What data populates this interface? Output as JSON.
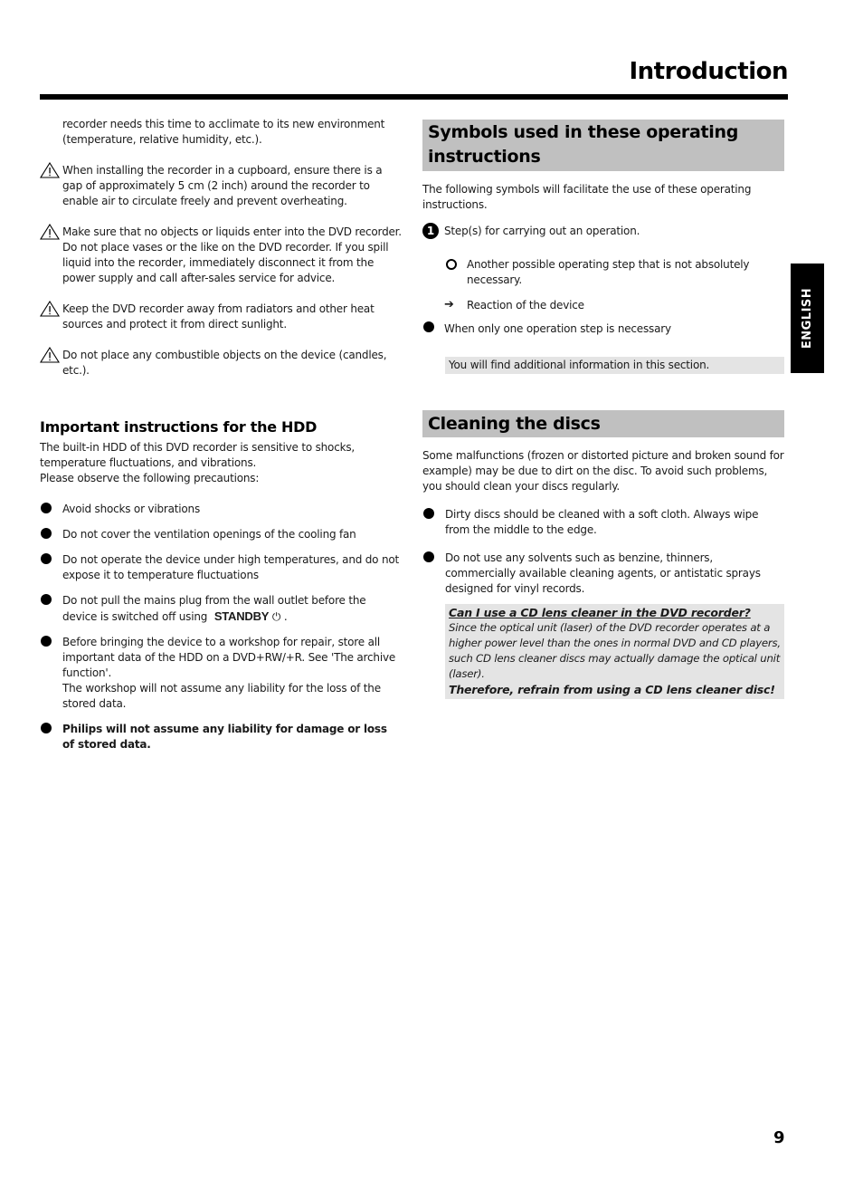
{
  "header": {
    "title": "Introduction"
  },
  "left": {
    "intro_text": "recorder needs this time to acclimate to its new environment (temperature, relative humidity, etc.).",
    "warnings": [
      {
        "icon": "warning-triangle-icon",
        "text": "When installing the recorder in a cupboard, ensure there is a gap of approximately 5 cm (2 inch) around the recorder to enable air to circulate freely and prevent overheating."
      },
      {
        "icon": "warning-triangle-icon",
        "text": "Make sure that no objects or liquids enter into the DVD recorder. Do not place vases or the like on the DVD recorder. If you spill liquid into the recorder, immediately disconnect it from the power supply and call after-sales service for advice."
      },
      {
        "icon": "warning-triangle-icon",
        "text": "Keep the DVD recorder away from radiators and other heat sources and protect it from direct sunlight."
      },
      {
        "icon": "warning-triangle-icon",
        "text": "Do not place any combustible objects on the device (candles, etc.)."
      }
    ],
    "hdd": {
      "heading": "Important instructions for the HDD",
      "intro_lines": [
        "The built-in HDD of this DVD recorder is sensitive to shocks, temperature fluctuations, and vibrations.",
        "Please observe the following precautions:"
      ],
      "bullets": [
        {
          "text": "Avoid shocks or vibrations"
        },
        {
          "text": "Do not cover the ventilation openings of the cooling fan"
        },
        {
          "text": "Do not operate the device under high temperatures, and do not expose it to temperature fluctuations"
        },
        {
          "text": "Do not pull the mains plug from the wall outlet before the device is switched off using",
          "key": "STANDBY",
          "key_icon": "power-icon",
          "key_glyph": "⏻",
          "suffix": " ."
        },
        {
          "text": "Before bringing the device to a workshop for repair, store all important data of the HDD on a DVD+RW/+R. See 'The archive function'.",
          "text2": "The workshop will not assume any liability for the loss of the stored data."
        },
        {
          "text": "Philips will not assume any liability for damage or loss of stored data.",
          "bold": true
        }
      ]
    }
  },
  "right": {
    "symbols": {
      "heading": "Symbols used in these operating instructions",
      "intro": "The following symbols will facilitate the use of these operating instructions.",
      "step": {
        "icon": "step-number-icon",
        "glyph": "1",
        "text": "Step(s) for carrying out an operation."
      },
      "optional": {
        "icon": "ring-icon",
        "text": "Another possible operating step that is not absolutely necessary."
      },
      "reaction": {
        "icon": "arrow-right-icon",
        "glyph": "➔",
        "text": "Reaction of the device"
      },
      "single": {
        "icon": "bullet-icon",
        "text": "When only one operation step is necessary"
      },
      "info": "You will find additional information in this section."
    },
    "cleaning": {
      "heading": "Cleaning the discs",
      "intro": "Some malfunctions (frozen or distorted picture and broken sound for example) may be due to dirt on the disc. To avoid such problems, you should clean your discs regularly.",
      "bullets": [
        {
          "text": "Dirty discs should be cleaned with a soft cloth. Always wipe from the middle to the edge."
        },
        {
          "text": "Do not use any solvents such as benzine, thinners, commercially available cleaning agents, or antistatic sprays designed for vinyl records."
        }
      ],
      "qa": {
        "question": "Can I use a CD lens cleaner in the DVD recorder?",
        "answer": "Since the optical unit (laser) of the DVD recorder operates at a higher power level than the ones in normal DVD and CD players, such CD lens cleaner discs may actually damage the optical unit (laser).",
        "conclusion": "Therefore, refrain from using a CD lens cleaner disc!"
      }
    }
  },
  "side_tab": {
    "label": "ENGLISH"
  },
  "footer": {
    "page_number": "9"
  }
}
